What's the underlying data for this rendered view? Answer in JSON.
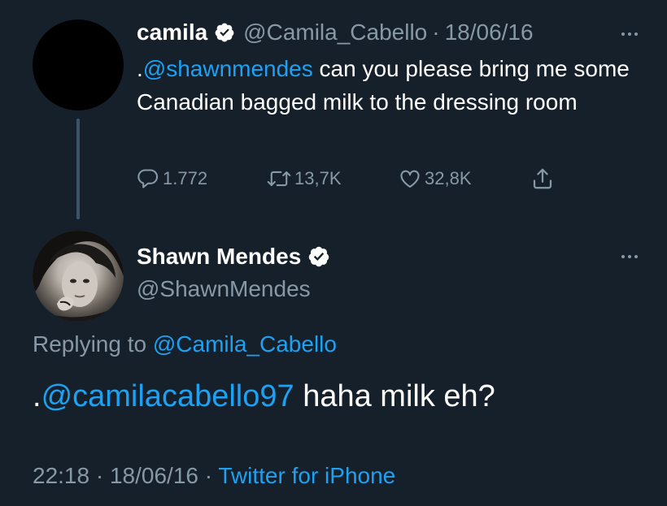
{
  "top_tweet": {
    "name": "camila",
    "handle": "@Camila_Cabello",
    "separator": "·",
    "date": "18/06/16",
    "text_prefix": ".",
    "mention": "@shawnmendes",
    "text_rest": " can you please bring me some Canadian bagged milk to the dressing room",
    "actions": {
      "replies": "1.772",
      "retweets": "13,7K",
      "likes": "32,8K"
    }
  },
  "reply_tweet": {
    "name": "Shawn Mendes",
    "handle": "@ShawnMendes",
    "replying_label": "Replying to ",
    "replying_handle": "@Camila_Cabello",
    "text_prefix": ".",
    "mention": "@camilacabello97",
    "text_rest": " haha milk eh?",
    "time": "22:18",
    "separator": "·",
    "date": "18/06/16",
    "source": "Twitter for iPhone"
  },
  "colors": {
    "background": "#15202b",
    "text": "#ffffff",
    "muted": "#8899a6",
    "link": "#1da1f2",
    "thread_line": "#3d5466"
  }
}
